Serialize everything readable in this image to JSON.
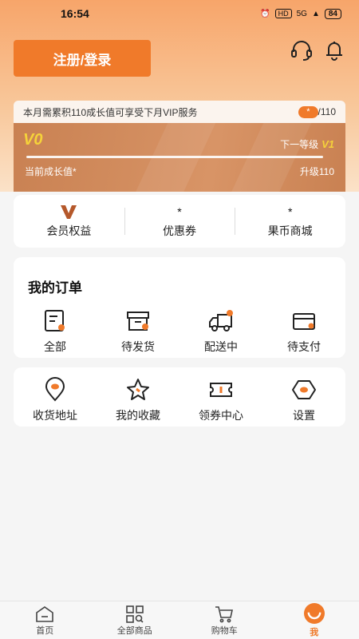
{
  "status_bar": {
    "time": "16:54",
    "net": "HD",
    "signal": "5G",
    "battery": "84"
  },
  "header": {
    "login_label": "注册/登录"
  },
  "vip": {
    "notice": "本月需累积110成长值可享受下月VIP服务",
    "current_value": "*",
    "target": "/110",
    "level": "V0",
    "next_level_label": "下一等级",
    "next_level": "V1",
    "progress": 0,
    "current_growth_label": "当前成长值*",
    "upgrade_label": "升级110"
  },
  "stats": [
    {
      "value": "",
      "label": "会员权益"
    },
    {
      "value": "*",
      "label": "优惠券"
    },
    {
      "value": "*",
      "label": "果币商城"
    }
  ],
  "orders": {
    "title": "我的订单",
    "items": [
      {
        "label": "全部",
        "icon": "all-orders-icon"
      },
      {
        "label": "待发货",
        "icon": "box-icon"
      },
      {
        "label": "配送中",
        "icon": "truck-icon"
      },
      {
        "label": "待支付",
        "icon": "card-icon"
      }
    ]
  },
  "tools": {
    "items": [
      {
        "label": "收货地址",
        "icon": "location-pin-icon"
      },
      {
        "label": "我的收藏",
        "icon": "star-icon"
      },
      {
        "label": "领券中心",
        "icon": "ticket-icon"
      },
      {
        "label": "设置",
        "icon": "settings-icon"
      }
    ]
  },
  "tabs": [
    {
      "label": "首页",
      "icon": "home-icon"
    },
    {
      "label": "全部商品",
      "icon": "grid-icon"
    },
    {
      "label": "购物车",
      "icon": "cart-icon"
    },
    {
      "label": "我",
      "icon": "profile-icon",
      "active": true
    }
  ],
  "colors": {
    "accent": "#f07a2a",
    "vip_card": "#c98152",
    "gold": "#f5d23a"
  }
}
